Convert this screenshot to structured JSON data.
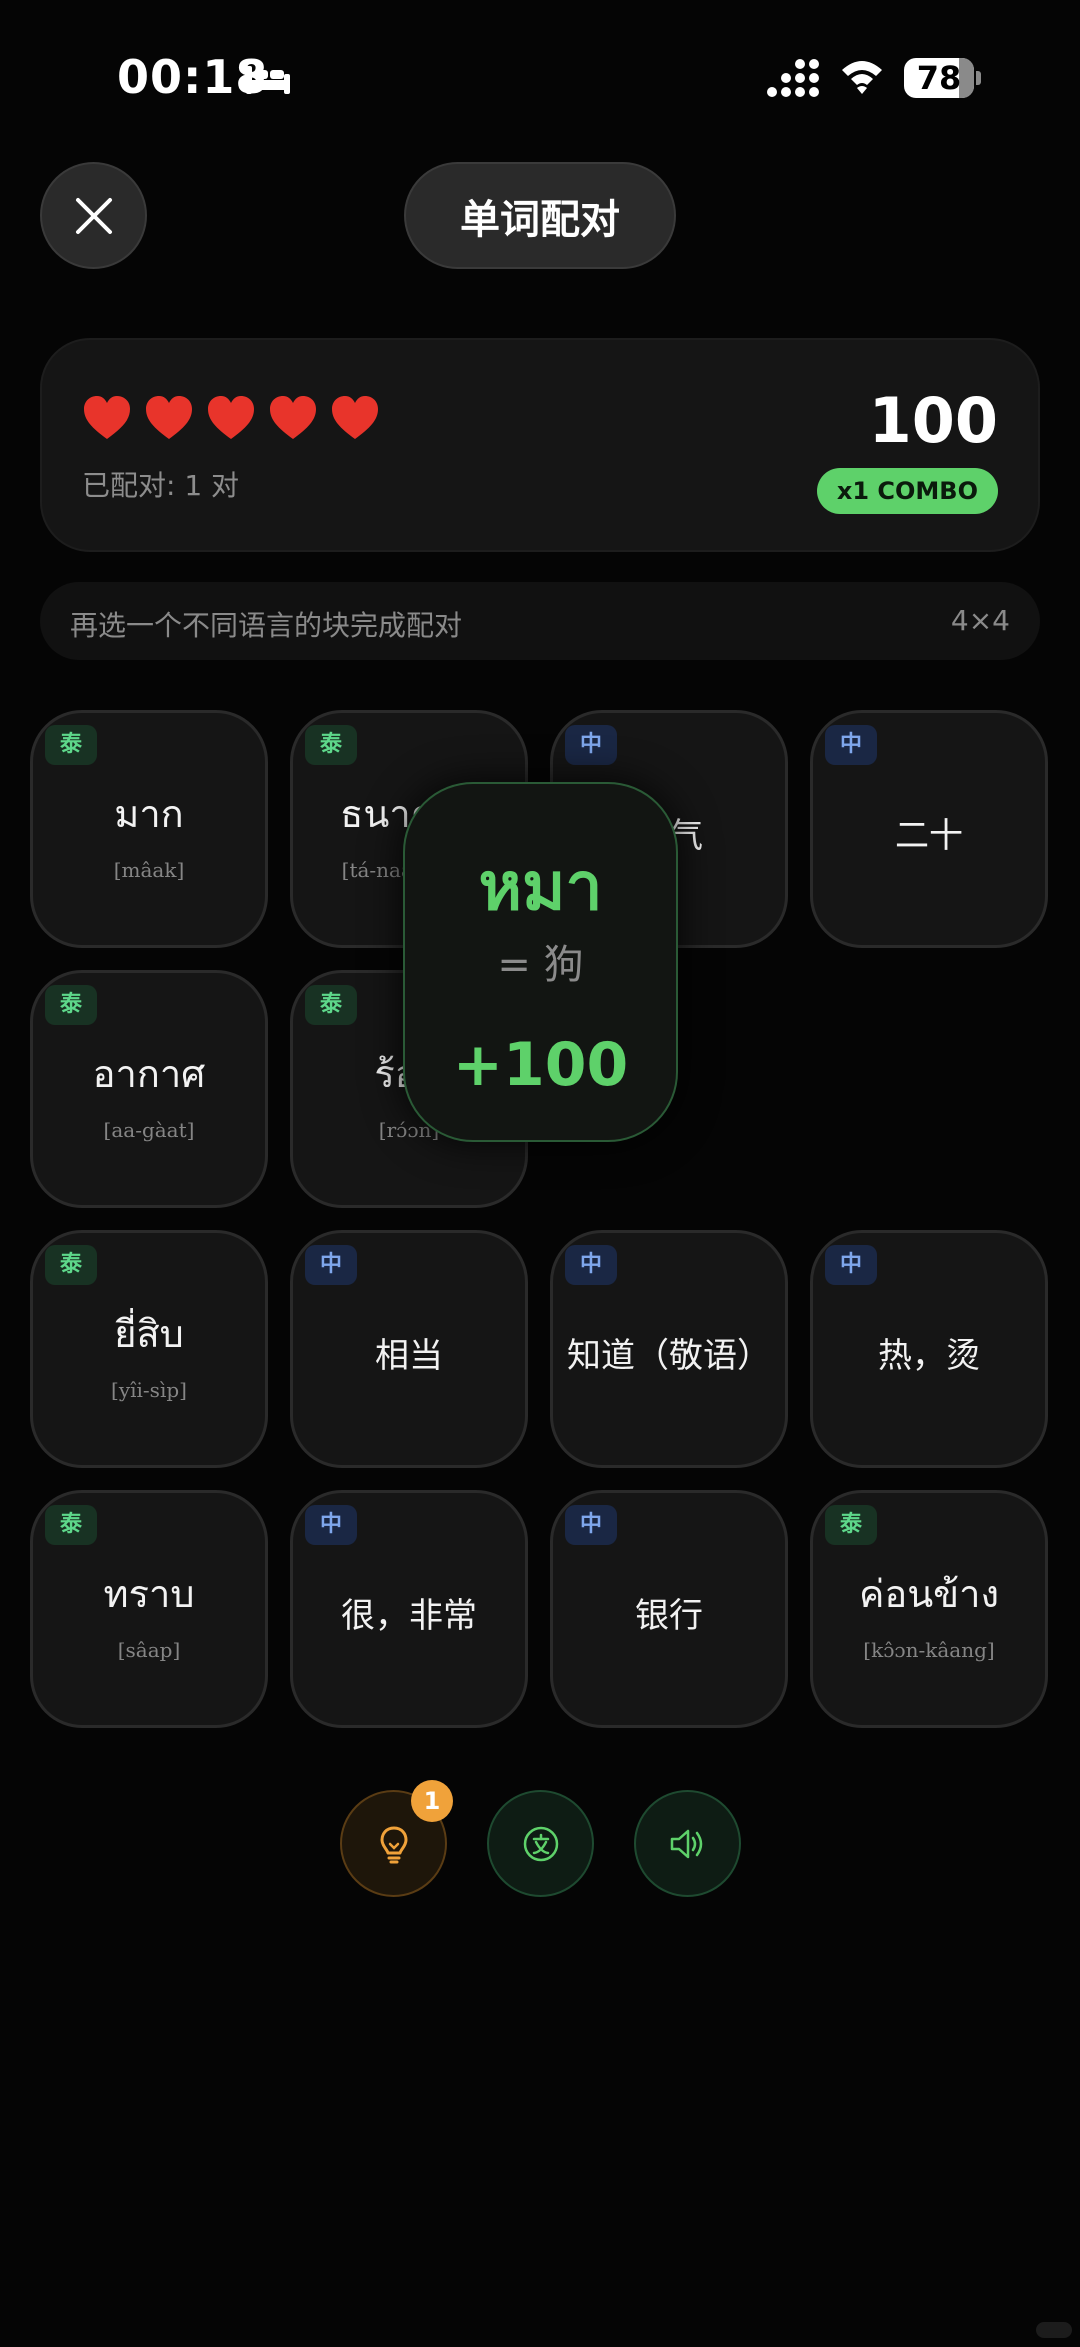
{
  "status_bar": {
    "time": "00:18",
    "battery_percent": "78",
    "battery_level": 0.78
  },
  "header": {
    "title": "单词配对"
  },
  "score_card": {
    "lives": 5,
    "pairs_label": "已配对: 1 对",
    "score": "100",
    "combo": "x1 COMBO"
  },
  "hint_bar": {
    "text": "再选一个不同语言的块完成配对",
    "grid_size": "4×4"
  },
  "tiles": [
    {
      "lang": "泰",
      "word": "มาก",
      "roman": "[mâak]"
    },
    {
      "lang": "泰",
      "word": "ธนาคาร",
      "roman": "[tá-naa-kaan]"
    },
    {
      "lang": "中",
      "word": "空气"
    },
    {
      "lang": "中",
      "word": "二十"
    },
    {
      "lang": "泰",
      "word": "อากาศ",
      "roman": "[aa-gàat]"
    },
    {
      "lang": "泰",
      "word": "ร้อน",
      "roman": "[rɔ́ɔn]"
    },
    {
      "lang": "泰",
      "word": "ยี่สิบ",
      "roman": "[yîi-sìp]"
    },
    {
      "lang": "中",
      "word": "相当"
    },
    {
      "lang": "中",
      "word": "知道（敬语）"
    },
    {
      "lang": "中",
      "word": "热，烫"
    },
    {
      "lang": "泰",
      "word": "ทราบ",
      "roman": "[sâap]"
    },
    {
      "lang": "中",
      "word": "很，非常"
    },
    {
      "lang": "中",
      "word": "银行"
    },
    {
      "lang": "泰",
      "word": "ค่อนข้าง",
      "roman": "[kɔ̂ɔn-kâang]"
    }
  ],
  "match_popup": {
    "word": "หมา",
    "translation": "= 狗",
    "points": "+100"
  },
  "tools": {
    "hint_count": "1"
  },
  "colors": {
    "accent_green": "#5ed16a",
    "hint_orange": "#f0a23a",
    "thai_badge": "#5ed88b",
    "chinese_badge": "#7fa7ec"
  }
}
